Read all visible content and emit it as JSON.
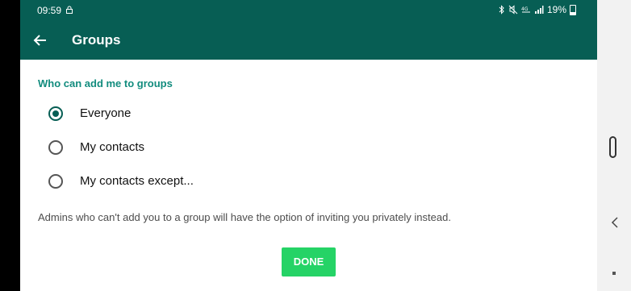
{
  "status_bar": {
    "time": "09:59",
    "battery": "19%",
    "icons": [
      "lock-icon",
      "bluetooth-icon",
      "mute-icon",
      "lte-icon",
      "signal-icon",
      "battery-icon"
    ]
  },
  "header": {
    "title": "Groups",
    "back_icon": "arrow-left-icon"
  },
  "section": {
    "title": "Who can add me to groups"
  },
  "options": [
    {
      "label": "Everyone",
      "selected": true
    },
    {
      "label": "My contacts",
      "selected": false
    },
    {
      "label": "My contacts except...",
      "selected": false
    }
  ],
  "note": "Admins who can't add you to a group will have the option of inviting you privately instead.",
  "done_button": {
    "label": "DONE"
  },
  "colors": {
    "primary_dark": "#075e54",
    "accent_text": "#128c7e",
    "button": "#25d366"
  }
}
